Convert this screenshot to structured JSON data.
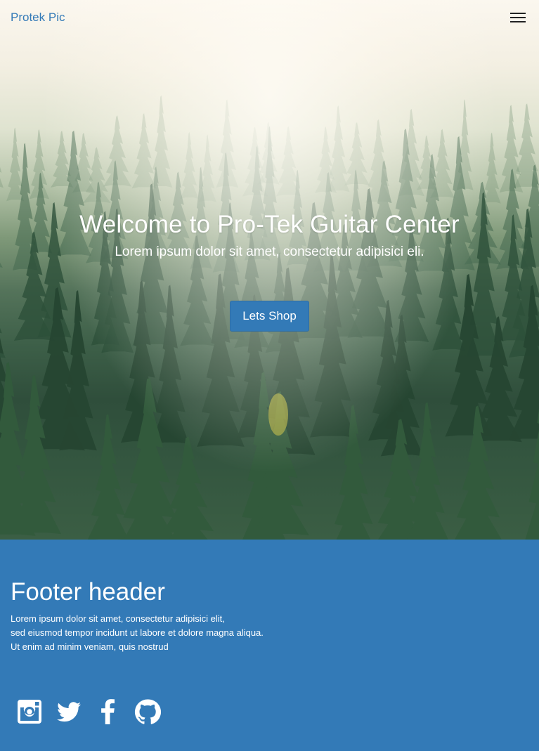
{
  "navbar": {
    "brand": "Protek Pic",
    "menu_icon": "hamburger-menu-icon"
  },
  "hero": {
    "title": "Welcome to Pro-Tek Guitar Center",
    "subtitle": "Lorem ipsum dolor sit amet, consectetur adipisici eli.",
    "cta_label": "Lets Shop",
    "background_image": "misty pine forest"
  },
  "footer": {
    "title": "Footer header",
    "lines": [
      "Lorem ipsum dolor sit amet, consectetur adipisici elit,",
      "sed eiusmod tempor incidunt ut labore et dolore magna aliqua.",
      "Ut enim ad minim veniam, quis nostrud"
    ],
    "social_icons": [
      "instagram-icon",
      "twitter-icon",
      "facebook-icon",
      "github-icon"
    ]
  },
  "colors": {
    "primary": "#337ab7",
    "nav_background": "#fdfaf4",
    "text_light": "#ffffff"
  }
}
